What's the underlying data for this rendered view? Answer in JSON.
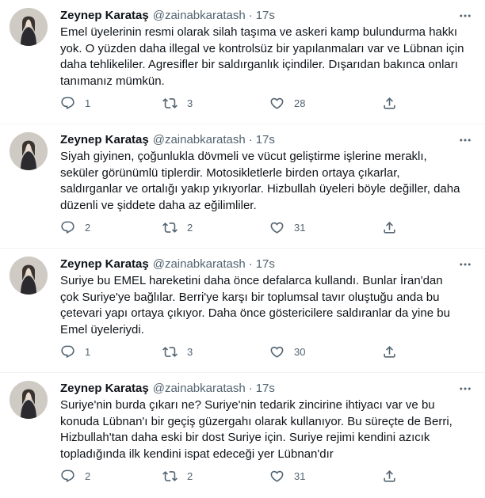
{
  "colors": {
    "text": "#0f1419",
    "secondary": "#536471",
    "divider": "#eff3f4",
    "background": "#ffffff"
  },
  "icons": {
    "reply": "reply-bubble-icon",
    "retweet": "retweet-arrows-icon",
    "like": "heart-icon",
    "share": "share-upload-icon",
    "more": "more-dots-icon"
  },
  "tweets": [
    {
      "author": {
        "name": "Zeynep Karataş",
        "handle": "@zainabkaratash"
      },
      "time": "17s",
      "lines": [
        "Emel üyelerinin resmi olarak silah taşıma ve askeri kamp bulundurma hakkı",
        "yok. O yüzden daha illegal ve kontrolsüz bir yapılanmaları var ve Lübnan için",
        "daha tehlikeliler. Agresifler bir saldırganlık içindiler. Dışarıdan bakınca onları",
        "tanımanız mümkün."
      ],
      "stats": {
        "replies": "1",
        "retweets": "3",
        "likes": "28"
      }
    },
    {
      "author": {
        "name": "Zeynep Karataş",
        "handle": "@zainabkaratash"
      },
      "time": "17s",
      "lines": [
        "Siyah giyinen, çoğunluklа dövmeli ve vücut geliştirme işlerine meraklı,",
        "seküler görünümlü tiplerdir. Motosikletlerle birden ortaya çıkarlar,",
        "saldırganlar ve ortalığı yakıp yıkıyorlar. Hizbullah üyeleri böyle değiller, daha",
        "düzenli ve şiddete daha az eğilimliler."
      ],
      "stats": {
        "replies": "2",
        "retweets": "2",
        "likes": "31"
      }
    },
    {
      "author": {
        "name": "Zeynep Karataş",
        "handle": "@zainabkaratash"
      },
      "time": "17s",
      "lines": [
        "Suriye bu EMEL hareketini daha önce defalarca kullandı. Bunlar İran'dan",
        "çok Suriye'ye bağlılar. Berri'ye karşı bir toplumsal tavır oluştuğu anda bu",
        "çetevari yapı ortaya çıkıyor. Daha önce göstericilere saldıranlar da yine bu",
        "Emel üyeleriydi."
      ],
      "stats": {
        "replies": "1",
        "retweets": "3",
        "likes": "30"
      }
    },
    {
      "author": {
        "name": "Zeynep Karataş",
        "handle": "@zainabkaratash"
      },
      "time": "17s",
      "lines": [
        "Suriye'nin burda çıkarı ne? Suriye'nin tedarik zincirine ihtiyacı var ve bu",
        "konuda Lübnan'ı bir geçiş güzergahı olarak kullanıyor. Bu süreçte de Berri,",
        "Hizbullah'tan daha eski bir dost Suriye için. Suriye rejimi kendini azıcık",
        "topladığında ilk kendini ispat edeceği yer Lübnan'dır"
      ],
      "stats": {
        "replies": "2",
        "retweets": "2",
        "likes": "31"
      }
    }
  ]
}
